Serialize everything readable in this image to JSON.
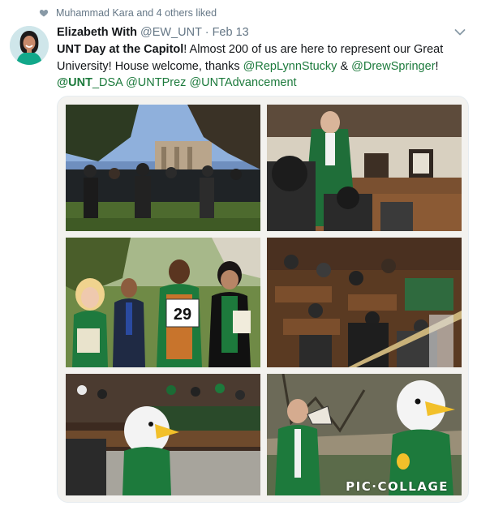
{
  "activity": {
    "liked_text": "Muhammad Kara and 4 others liked"
  },
  "tweet": {
    "author_name": "Elizabeth With",
    "handle": "@EW_UNT",
    "separator": "·",
    "date": "Feb 13",
    "lines": {
      "l1_bold": "UNT Day at the Capitol",
      "l1_rest": "!  Almost 200 of us are here to represent our Great",
      "l2_a": "University!  House welcome, thanks ",
      "l2_m1": "@RepLynnStucky",
      "l2_b": " & ",
      "l2_m2": "@DrewSpringer",
      "l2_c": "!",
      "l3_m1_bold": "@UNT",
      "l3_m1_rest": "_DSA",
      "l3_sp1": " ",
      "l3_m2": "@UNTPrez",
      "l3_sp2": " ",
      "l3_m3": "@UNTAdvancement"
    },
    "media": {
      "watermark": "PIC·COLLAGE",
      "sign_number": "29"
    }
  },
  "colors": {
    "unt_green": "#1c7a3c",
    "muted": "#657786",
    "heart": "#8899a6"
  },
  "icons": {
    "liked": "heart-icon",
    "menu": "chevron-down-icon"
  }
}
